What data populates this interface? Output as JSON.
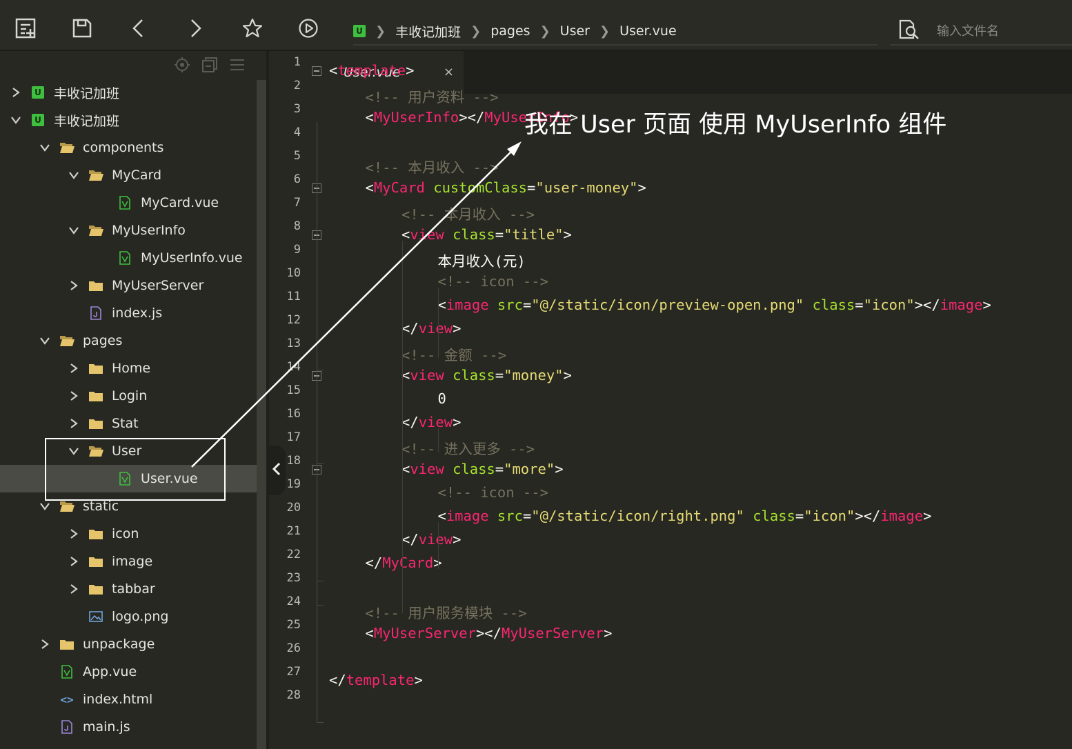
{
  "toolbar": {
    "buttons": [
      {
        "name": "new-file",
        "icon": "new-file-icon"
      },
      {
        "name": "save",
        "icon": "save-icon"
      },
      {
        "name": "back",
        "icon": "chevron-left-icon"
      },
      {
        "name": "forward",
        "icon": "chevron-right-icon"
      },
      {
        "name": "favorite",
        "icon": "star-icon"
      },
      {
        "name": "run",
        "icon": "play-icon"
      }
    ],
    "breadcrumb": {
      "project": "丰收记加班",
      "items": [
        "pages",
        "User",
        "User.vue"
      ]
    },
    "file_search": {
      "placeholder": "输入文件名"
    }
  },
  "sidebar": {
    "tree": [
      {
        "label": "丰收记加班",
        "type": "project",
        "depth": 0,
        "expanded": false
      },
      {
        "label": "丰收记加班",
        "type": "project",
        "depth": 0,
        "expanded": true
      },
      {
        "label": "components",
        "type": "folder",
        "depth": 1,
        "expanded": true
      },
      {
        "label": "MyCard",
        "type": "folder",
        "depth": 2,
        "expanded": true
      },
      {
        "label": "MyCard.vue",
        "type": "vue",
        "depth": 3
      },
      {
        "label": "MyUserInfo",
        "type": "folder",
        "depth": 2,
        "expanded": true
      },
      {
        "label": "MyUserInfo.vue",
        "type": "vue",
        "depth": 3
      },
      {
        "label": "MyUserServer",
        "type": "folder",
        "depth": 2,
        "expanded": false
      },
      {
        "label": "index.js",
        "type": "js",
        "depth": 2
      },
      {
        "label": "pages",
        "type": "folder",
        "depth": 1,
        "expanded": true
      },
      {
        "label": "Home",
        "type": "folder",
        "depth": 2,
        "expanded": false
      },
      {
        "label": "Login",
        "type": "folder",
        "depth": 2,
        "expanded": false
      },
      {
        "label": "Stat",
        "type": "folder",
        "depth": 2,
        "expanded": false
      },
      {
        "label": "User",
        "type": "folder",
        "depth": 2,
        "expanded": true
      },
      {
        "label": "User.vue",
        "type": "vue",
        "depth": 3,
        "selected": true
      },
      {
        "label": "static",
        "type": "folder",
        "depth": 1,
        "expanded": true
      },
      {
        "label": "icon",
        "type": "folder",
        "depth": 2,
        "expanded": false
      },
      {
        "label": "image",
        "type": "folder",
        "depth": 2,
        "expanded": false
      },
      {
        "label": "tabbar",
        "type": "folder",
        "depth": 2,
        "expanded": false
      },
      {
        "label": "logo.png",
        "type": "image",
        "depth": 2
      },
      {
        "label": "unpackage",
        "type": "folder",
        "depth": 1,
        "expanded": false
      },
      {
        "label": "App.vue",
        "type": "vue",
        "depth": 1
      },
      {
        "label": "index.html",
        "type": "html",
        "depth": 1
      },
      {
        "label": "main.js",
        "type": "js",
        "depth": 1
      }
    ]
  },
  "editor": {
    "tab": {
      "title": "User.vue",
      "close": "×"
    },
    "lines": [
      {
        "n": "1",
        "indent": 0,
        "fold": true,
        "tokens": [
          [
            "punc",
            "<"
          ],
          [
            "tag",
            "template"
          ],
          [
            "punc",
            ">"
          ]
        ]
      },
      {
        "n": "2",
        "indent": 1,
        "tokens": [
          [
            "cmt",
            "<!-- 用户资料 -->"
          ]
        ]
      },
      {
        "n": "3",
        "indent": 1,
        "tokens": [
          [
            "punc",
            "<"
          ],
          [
            "tag",
            "MyUserInfo"
          ],
          [
            "punc",
            "></"
          ],
          [
            "tag",
            "MyUserInfo"
          ],
          [
            "punc",
            ">"
          ]
        ]
      },
      {
        "n": "4",
        "indent": 0,
        "tokens": []
      },
      {
        "n": "5",
        "indent": 1,
        "tokens": [
          [
            "cmt",
            "<!-- 本月收入 -->"
          ]
        ]
      },
      {
        "n": "6",
        "indent": 1,
        "fold": true,
        "tokens": [
          [
            "punc",
            "<"
          ],
          [
            "tag",
            "MyCard"
          ],
          [
            "punc",
            " "
          ],
          [
            "attr",
            "customClass"
          ],
          [
            "punc",
            "="
          ],
          [
            "str",
            "\"user-money\""
          ],
          [
            "punc",
            ">"
          ]
        ]
      },
      {
        "n": "7",
        "indent": 2,
        "tokens": [
          [
            "cmt",
            "<!-- 本月收入 -->"
          ]
        ]
      },
      {
        "n": "8",
        "indent": 2,
        "fold": true,
        "tokens": [
          [
            "punc",
            "<"
          ],
          [
            "tag",
            "view"
          ],
          [
            "punc",
            " "
          ],
          [
            "attr",
            "class"
          ],
          [
            "punc",
            "="
          ],
          [
            "str",
            "\"title\""
          ],
          [
            "punc",
            ">"
          ]
        ]
      },
      {
        "n": "9",
        "indent": 3,
        "tokens": [
          [
            "txt",
            "本月收入(元)"
          ]
        ]
      },
      {
        "n": "10",
        "indent": 3,
        "tokens": [
          [
            "cmt",
            "<!-- icon -->"
          ]
        ]
      },
      {
        "n": "11",
        "indent": 3,
        "tokens": [
          [
            "punc",
            "<"
          ],
          [
            "tag",
            "image"
          ],
          [
            "punc",
            " "
          ],
          [
            "attr",
            "src"
          ],
          [
            "punc",
            "="
          ],
          [
            "str",
            "\"@/static/icon/preview-open.png\""
          ],
          [
            "punc",
            " "
          ],
          [
            "attr",
            "class"
          ],
          [
            "punc",
            "="
          ],
          [
            "str",
            "\"icon\""
          ],
          [
            "punc",
            "></"
          ],
          [
            "tag",
            "image"
          ],
          [
            "punc",
            ">"
          ]
        ]
      },
      {
        "n": "12",
        "indent": 2,
        "tokens": [
          [
            "punc",
            "</"
          ],
          [
            "tag",
            "view"
          ],
          [
            "punc",
            ">"
          ]
        ]
      },
      {
        "n": "13",
        "indent": 2,
        "tokens": [
          [
            "cmt",
            "<!-- 金额 -->"
          ]
        ]
      },
      {
        "n": "14",
        "indent": 2,
        "fold": true,
        "tokens": [
          [
            "punc",
            "<"
          ],
          [
            "tag",
            "view"
          ],
          [
            "punc",
            " "
          ],
          [
            "attr",
            "class"
          ],
          [
            "punc",
            "="
          ],
          [
            "str",
            "\"money\""
          ],
          [
            "punc",
            ">"
          ]
        ]
      },
      {
        "n": "15",
        "indent": 3,
        "tokens": [
          [
            "txt",
            "0"
          ]
        ]
      },
      {
        "n": "16",
        "indent": 2,
        "tokens": [
          [
            "punc",
            "</"
          ],
          [
            "tag",
            "view"
          ],
          [
            "punc",
            ">"
          ]
        ]
      },
      {
        "n": "17",
        "indent": 2,
        "tokens": [
          [
            "cmt",
            "<!-- 进入更多 -->"
          ]
        ]
      },
      {
        "n": "18",
        "indent": 2,
        "fold": true,
        "tokens": [
          [
            "punc",
            "<"
          ],
          [
            "tag",
            "view"
          ],
          [
            "punc",
            " "
          ],
          [
            "attr",
            "class"
          ],
          [
            "punc",
            "="
          ],
          [
            "str",
            "\"more\""
          ],
          [
            "punc",
            ">"
          ]
        ]
      },
      {
        "n": "19",
        "indent": 3,
        "tokens": [
          [
            "cmt",
            "<!-- icon -->"
          ]
        ]
      },
      {
        "n": "20",
        "indent": 3,
        "tokens": [
          [
            "punc",
            "<"
          ],
          [
            "tag",
            "image"
          ],
          [
            "punc",
            " "
          ],
          [
            "attr",
            "src"
          ],
          [
            "punc",
            "="
          ],
          [
            "str",
            "\"@/static/icon/right.png\""
          ],
          [
            "punc",
            " "
          ],
          [
            "attr",
            "class"
          ],
          [
            "punc",
            "="
          ],
          [
            "str",
            "\"icon\""
          ],
          [
            "punc",
            "></"
          ],
          [
            "tag",
            "image"
          ],
          [
            "punc",
            ">"
          ]
        ]
      },
      {
        "n": "21",
        "indent": 2,
        "tokens": [
          [
            "punc",
            "</"
          ],
          [
            "tag",
            "view"
          ],
          [
            "punc",
            ">"
          ]
        ]
      },
      {
        "n": "22",
        "indent": 1,
        "tokens": [
          [
            "punc",
            "</"
          ],
          [
            "tag",
            "MyCard"
          ],
          [
            "punc",
            ">"
          ]
        ]
      },
      {
        "n": "23",
        "indent": 0,
        "tokens": []
      },
      {
        "n": "24",
        "indent": 1,
        "tokens": [
          [
            "cmt",
            "<!-- 用户服务模块 -->"
          ]
        ]
      },
      {
        "n": "25",
        "indent": 1,
        "tokens": [
          [
            "punc",
            "<"
          ],
          [
            "tag",
            "MyUserServer"
          ],
          [
            "punc",
            "></"
          ],
          [
            "tag",
            "MyUserServer"
          ],
          [
            "punc",
            ">"
          ]
        ]
      },
      {
        "n": "26",
        "indent": 0,
        "tokens": []
      },
      {
        "n": "27",
        "indent": 0,
        "tokens": [
          [
            "punc",
            "</"
          ],
          [
            "tag",
            "template"
          ],
          [
            "punc",
            ">"
          ]
        ]
      },
      {
        "n": "28",
        "indent": 0,
        "tokens": []
      }
    ]
  },
  "annotation": {
    "text": "我在 User 页面 使用 MyUserInfo 组件"
  },
  "colors": {
    "background": "#272822",
    "tag": "#f92672",
    "attribute": "#a6e22e",
    "string": "#e6db74",
    "comment": "#75715e",
    "text": "#f8f8f2",
    "folder": "#e8c36a",
    "vue_icon": "#3fbf3f",
    "js_icon": "#9a86d8"
  }
}
